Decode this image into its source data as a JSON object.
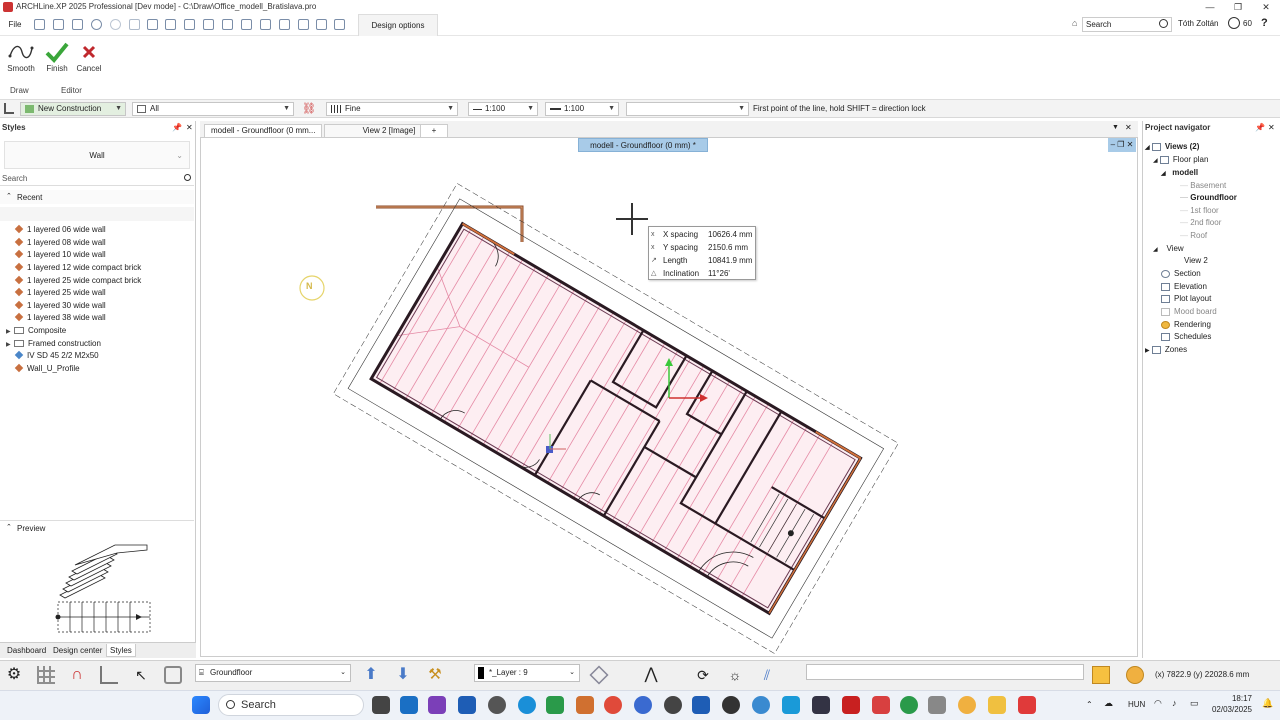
{
  "window": {
    "title": "ARCHLine.XP 2025 Professional [Dev mode] - C:\\Draw\\Office_modell_Bratislava.pro"
  },
  "quickbar": {
    "file_label": "File",
    "design_options_tab": "Design options",
    "search_placeholder": "Search",
    "user_name": "Tóth Zoltán",
    "counter": "60",
    "help": "?"
  },
  "ribbon": {
    "buttons": [
      {
        "label": "Smooth",
        "icon": "smooth-curve-icon"
      },
      {
        "label": "Finish",
        "icon": "checkmark-icon"
      },
      {
        "label": "Cancel",
        "icon": "close-icon"
      }
    ],
    "groups": [
      "Draw",
      "Editor"
    ]
  },
  "optionsbar": {
    "construction": "New Construction",
    "layer_filter": "All",
    "line_quality": "Fine",
    "scale1": "1:100",
    "scale2": "1:100",
    "empty_field": "",
    "prompt": "First point of the line, hold SHIFT = direction lock"
  },
  "styles_panel": {
    "title": "Styles",
    "selected_type": "Wall",
    "search_placeholder": "Search",
    "recent_label": "Recent",
    "items": [
      {
        "label": "1 layered 06 wide wall",
        "kind": "style"
      },
      {
        "label": "1 layered 08 wide wall",
        "kind": "style"
      },
      {
        "label": "1 layered 10 wide wall",
        "kind": "style"
      },
      {
        "label": "1 layered 12 wide compact brick",
        "kind": "style"
      },
      {
        "label": "1 layered 25 wide compact brick",
        "kind": "style"
      },
      {
        "label": "1 layered 25 wide wall",
        "kind": "style"
      },
      {
        "label": "1 layered 30 wide wall",
        "kind": "style"
      },
      {
        "label": "1 layered 38 wide wall",
        "kind": "style"
      },
      {
        "label": "Composite",
        "kind": "folder"
      },
      {
        "label": "Framed construction",
        "kind": "folder"
      },
      {
        "label": "IV SD 45 2/2 M2x50",
        "kind": "style-blue"
      },
      {
        "label": "Wall_U_Profile",
        "kind": "style"
      }
    ],
    "preview_label": "Preview",
    "tabs": [
      "Dashboard",
      "Design center",
      "Styles"
    ],
    "active_tab": "Styles"
  },
  "document_tabs": {
    "tabs": [
      "modell - Groundfloor (0 mm...",
      "View 2 [Image]",
      "+"
    ],
    "active": 0
  },
  "canvas": {
    "floor_badge": "modell - Groundfloor (0 mm) *",
    "north_label": "N",
    "tooltip": [
      {
        "glyph": "x",
        "label": "X spacing",
        "value": "10626.4 mm"
      },
      {
        "glyph": "x",
        "label": "Y spacing",
        "value": "2150.6 mm"
      },
      {
        "glyph": "↗",
        "label": "Length",
        "value": "10841.9 mm"
      },
      {
        "glyph": "△",
        "label": "Inclination",
        "value": "11°26'"
      }
    ]
  },
  "project_navigator": {
    "title": "Project navigator",
    "items": [
      {
        "label": "Views (2)",
        "bold": true,
        "indent": 0
      },
      {
        "label": "Floor plan",
        "indent": 1
      },
      {
        "label": "modell",
        "bold": true,
        "indent": 2
      },
      {
        "label": "Basement",
        "muted": true,
        "indent": 3
      },
      {
        "label": "Groundfloor",
        "bold": true,
        "indent": 3
      },
      {
        "label": "1st floor",
        "muted": true,
        "indent": 3
      },
      {
        "label": "2nd floor",
        "muted": true,
        "indent": 3
      },
      {
        "label": "Roof",
        "muted": true,
        "indent": 3
      },
      {
        "label": "View",
        "indent": 1
      },
      {
        "label": "View 2",
        "indent": 2
      },
      {
        "label": "Section",
        "indent": 1
      },
      {
        "label": "Elevation",
        "indent": 1
      },
      {
        "label": "Plot layout",
        "indent": 1
      },
      {
        "label": "Mood board",
        "muted": true,
        "indent": 1
      },
      {
        "label": "Rendering",
        "indent": 1
      },
      {
        "label": "Schedules",
        "indent": 1
      },
      {
        "label": "Zones",
        "indent": 0
      }
    ]
  },
  "statusbar": {
    "floor": "Groundfloor",
    "layer": "*_Layer : 9",
    "layer_color": "#000000",
    "coords": "(x) 7822.9  (y) 22028.6 mm"
  },
  "taskbar": {
    "search": "Search",
    "language": "HUN",
    "time": "18:17",
    "date": "02/03/2025"
  },
  "colors": {
    "accent": "#a8cbe8",
    "wall_pink": "#e58aa5",
    "wall_dark": "#2a1a22"
  }
}
